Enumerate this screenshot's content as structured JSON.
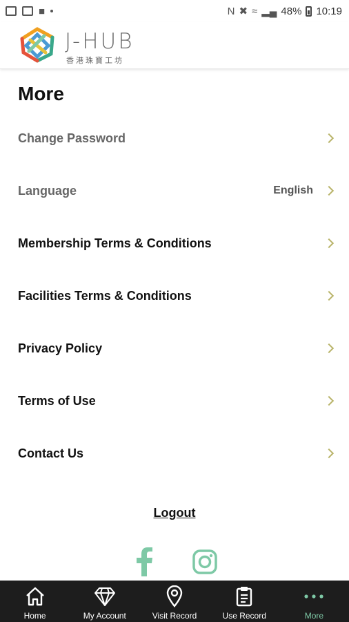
{
  "status_bar": {
    "battery": "48%",
    "time": "10:19"
  },
  "header": {
    "logo_text": "J-HUB",
    "logo_subtitle": "香港珠寶工坊"
  },
  "page": {
    "title": "More"
  },
  "menu": {
    "items": [
      {
        "label": "Change Password",
        "value": ""
      },
      {
        "label": "Language",
        "value": "English"
      },
      {
        "label": "Membership Terms & Conditions",
        "value": ""
      },
      {
        "label": "Facilities Terms & Conditions",
        "value": ""
      },
      {
        "label": "Privacy Policy",
        "value": ""
      },
      {
        "label": "Terms of Use",
        "value": ""
      },
      {
        "label": "Contact Us",
        "value": ""
      }
    ]
  },
  "logout_label": "Logout",
  "social": {
    "icons": [
      "facebook-icon",
      "instagram-icon"
    ],
    "color": "#7ec9a6"
  },
  "bottom_nav": {
    "items": [
      {
        "label": "Home",
        "icon": "home-icon"
      },
      {
        "label": "My Account",
        "icon": "diamond-icon"
      },
      {
        "label": "Visit Record",
        "icon": "location-pin-icon"
      },
      {
        "label": "Use Record",
        "icon": "clipboard-icon"
      },
      {
        "label": "More",
        "icon": "more-dots-icon"
      }
    ],
    "active_index": 4,
    "active_color": "#7ec9a6",
    "background": "#1d1d1d"
  },
  "colors": {
    "chevron": "#b9b46a",
    "accent": "#7ec9a6"
  }
}
